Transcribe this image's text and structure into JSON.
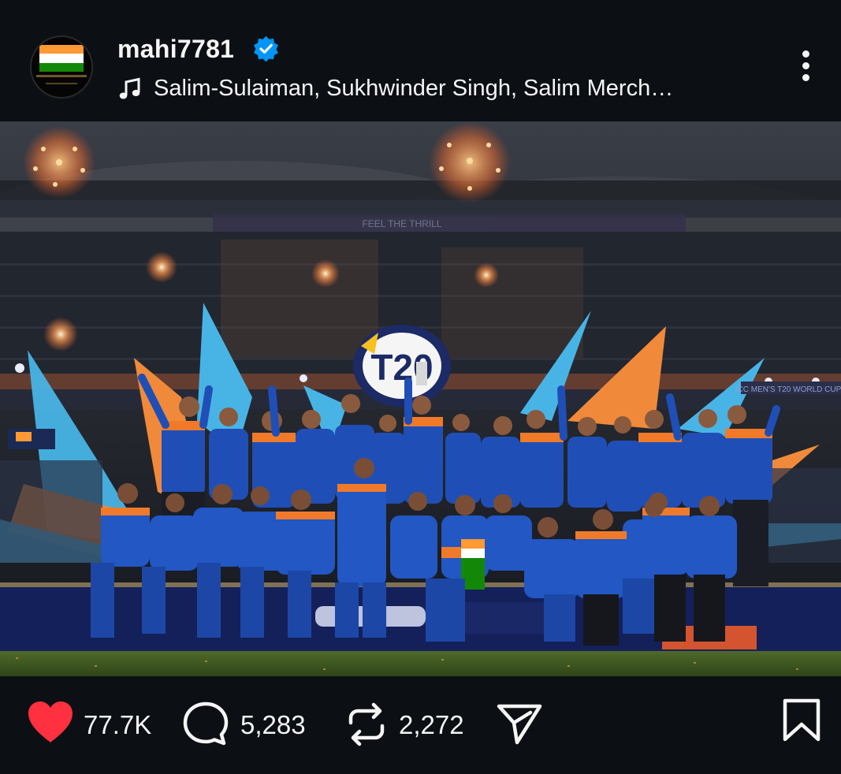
{
  "post": {
    "username": "mahi7781",
    "verified": true,
    "audio": "Salim-Sulaiman, Sukhwinder Singh, Salim Merch…"
  },
  "photo": {
    "banner_text": "FEEL THE THRILL",
    "event_text": "ICC MEN'S T20 WORLD CUP",
    "logo_text": "T20"
  },
  "actions": {
    "likes": "77.7K",
    "comments": "5,283",
    "reposts": "2,272"
  },
  "icons": {
    "avatar": "avatar-flag",
    "verified": "verified-badge-icon",
    "music": "music-note-icon",
    "more": "more-options-icon",
    "sound": "sound-on-icon",
    "like": "heart-icon",
    "comment": "comment-bubble-icon",
    "repost": "repost-icon",
    "share": "send-icon",
    "save": "bookmark-icon"
  },
  "colors": {
    "background": "#0c1014",
    "like_red": "#ff3040",
    "verified_blue": "#0095f6",
    "jersey_blue": "#1f4fb6",
    "accent_orange": "#f07a2a"
  }
}
